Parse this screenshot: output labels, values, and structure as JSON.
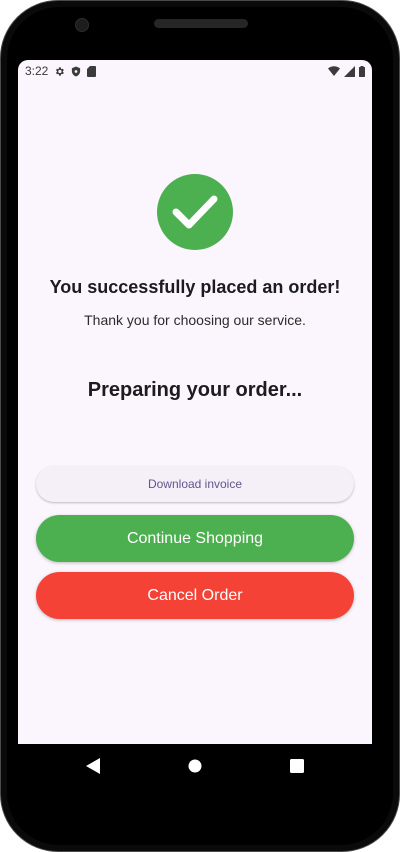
{
  "status_bar": {
    "time": "3:22",
    "left_icons": [
      "gear-icon",
      "shield-icon",
      "sd-card-icon"
    ],
    "right_icons": [
      "wifi-icon",
      "signal-icon",
      "battery-icon"
    ]
  },
  "order_confirmation": {
    "success_icon": "check-circle-icon",
    "title": "You successfully placed an order!",
    "subtitle": "Thank you for choosing our service.",
    "status": "Preparing your order..."
  },
  "actions": {
    "download_invoice": "Download invoice",
    "continue_shopping": "Continue Shopping",
    "cancel_order": "Cancel Order"
  },
  "navigation": {
    "buttons": [
      "back-icon",
      "home-icon",
      "recents-icon"
    ]
  },
  "colors": {
    "success": "#4CAF50",
    "danger": "#F44336",
    "accent_text": "#65558F",
    "screen_background": "#FBF6FD"
  }
}
